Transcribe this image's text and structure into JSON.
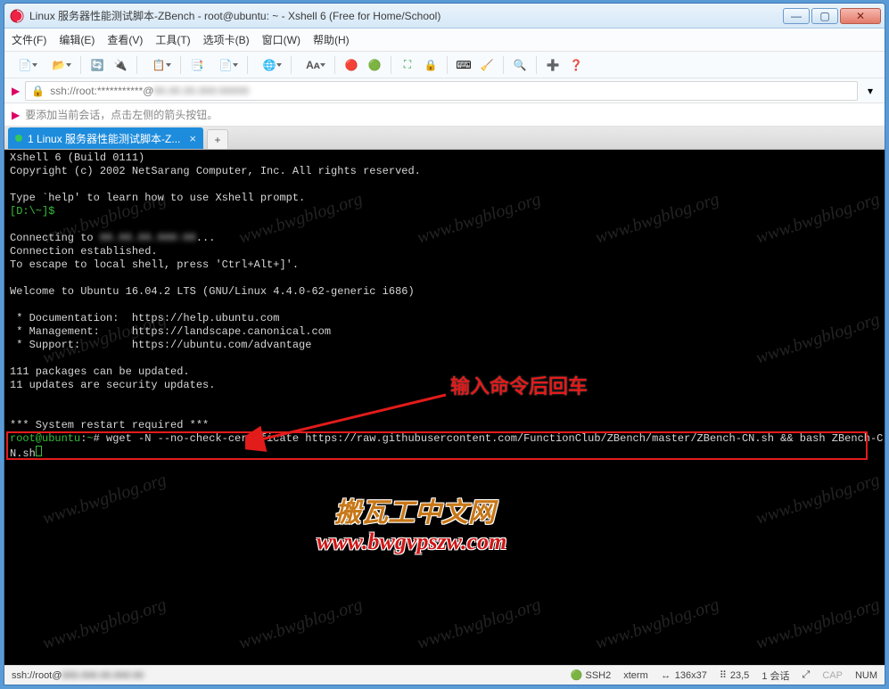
{
  "window": {
    "title": "Linux 服务器性能测试脚本-ZBench - root@ubuntu: ~ - Xshell 6 (Free for Home/School)"
  },
  "window_controls": {
    "min": "—",
    "max": "▢",
    "close": "✕"
  },
  "menu": {
    "file": "文件(F)",
    "edit": "编辑(E)",
    "view": "查看(V)",
    "tools": "工具(T)",
    "optiontab": "选项卡(B)",
    "window": "窗口(W)",
    "help": "帮助(H)"
  },
  "addressbar": {
    "text": "ssh://root:***********@"
  },
  "notice": {
    "text": "要添加当前会话，点击左侧的箭头按钮。"
  },
  "tab": {
    "label": "1 Linux 服务器性能测试脚本-Z...",
    "close": "×",
    "add": "+"
  },
  "terminal": {
    "l1": "Xshell 6 (Build 0111)",
    "l2": "Copyright (c) 2002 NetSarang Computer, Inc. All rights reserved.",
    "l3": "Type `help' to learn how to use Xshell prompt.",
    "prompt1": "[D:\\~]$",
    "l4a": "Connecting to ",
    "l4b": "...",
    "l5": "Connection established.",
    "l6": "To escape to local shell, press 'Ctrl+Alt+]'.",
    "l7": "Welcome to Ubuntu 16.04.2 LTS (GNU/Linux 4.4.0-62-generic i686)",
    "l8": " * Documentation:  https://help.ubuntu.com",
    "l9": " * Management:     https://landscape.canonical.com",
    "l10": " * Support:        https://ubuntu.com/advantage",
    "l11": "111 packages can be updated.",
    "l12": "11 updates are security updates.",
    "l13": "*** System restart required ***",
    "prompt2a": "root@ubuntu",
    "prompt2b": ":",
    "prompt2c": "~",
    "prompt2d": "# wget -N --no-check-certificate https://raw.githubusercontent.com/FunctionClub/ZBench/master/ZBench-CN.sh && bash ZBench-C",
    "prompt2e": "N.sh"
  },
  "annotation": {
    "label": "输入命令后回车"
  },
  "watermark": {
    "cn": "搬瓦工中文网",
    "url": "www.bwgvpszw.com",
    "diag": "www.bwgblog.org"
  },
  "statusbar": {
    "left": "ssh://root@",
    "ssh": "SSH2",
    "term": "xterm",
    "size": "136x37",
    "pos": "23,5",
    "sessions": "1 会话",
    "cap": "CAP",
    "num": "NUM"
  },
  "icons": {
    "new_session": "📄",
    "open": "📂",
    "reconnect": "🔄",
    "disconnect": "🔌",
    "properties": "📋",
    "copy": "📑",
    "paste": "📄",
    "globe": "🌐",
    "font": "Aᴀ",
    "color": "🎨",
    "xagent": "🔴",
    "xmanager": "🟢",
    "fullscreen": "⛶",
    "lock_scroll": "🔒",
    "keypad": "⌨",
    "clear": "🧹",
    "find": "🔍",
    "plus": "➕",
    "help": "❓",
    "lock": "🔒",
    "ssh_badge": "🟢",
    "term_badge": "↔",
    "resize": "⤢",
    "triangle_down": "▾",
    "flag": "▶"
  }
}
